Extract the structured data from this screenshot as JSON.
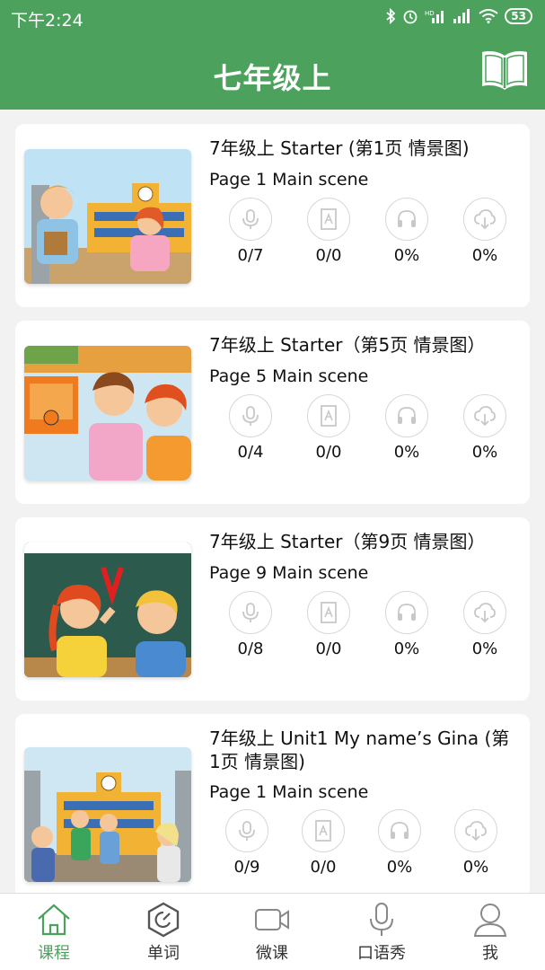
{
  "status_bar": {
    "time": "下午2:24",
    "battery": "53"
  },
  "header": {
    "title": "七年级上",
    "book_icon": "book-icon"
  },
  "lessons": [
    {
      "title": "7年级上 Starter (第1页 情景图)",
      "subtitle": "Page 1 Main scene",
      "stats": [
        "0/7",
        "0/0",
        "0%",
        "0%"
      ]
    },
    {
      "title": "7年级上 Starter（第5页 情景图）",
      "subtitle": "Page 5 Main scene",
      "stats": [
        "0/4",
        "0/0",
        "0%",
        "0%"
      ]
    },
    {
      "title": "7年级上 Starter（第9页 情景图）",
      "subtitle": "Page 9 Main scene",
      "stats": [
        "0/8",
        "0/0",
        "0%",
        "0%"
      ]
    },
    {
      "title": "7年级上 Unit1 My name’s Gina (第1页 情景图)",
      "subtitle": "Page 1 Main scene",
      "stats": [
        "0/9",
        "0/0",
        "0%",
        "0%"
      ]
    }
  ],
  "stat_icons": [
    "microphone-icon",
    "text-document-icon",
    "headphones-icon",
    "cloud-download-icon"
  ],
  "tabs": [
    {
      "label": "课程",
      "icon": "home-icon",
      "active": true
    },
    {
      "label": "单词",
      "icon": "hexagon-word-icon",
      "active": false
    },
    {
      "label": "微课",
      "icon": "video-camera-icon",
      "active": false
    },
    {
      "label": "口语秀",
      "icon": "microphone-icon",
      "active": false
    },
    {
      "label": "我",
      "icon": "user-icon",
      "active": false
    }
  ],
  "colors": {
    "primary": "#4ca25c",
    "icon_gray": "#c8c8c8"
  }
}
